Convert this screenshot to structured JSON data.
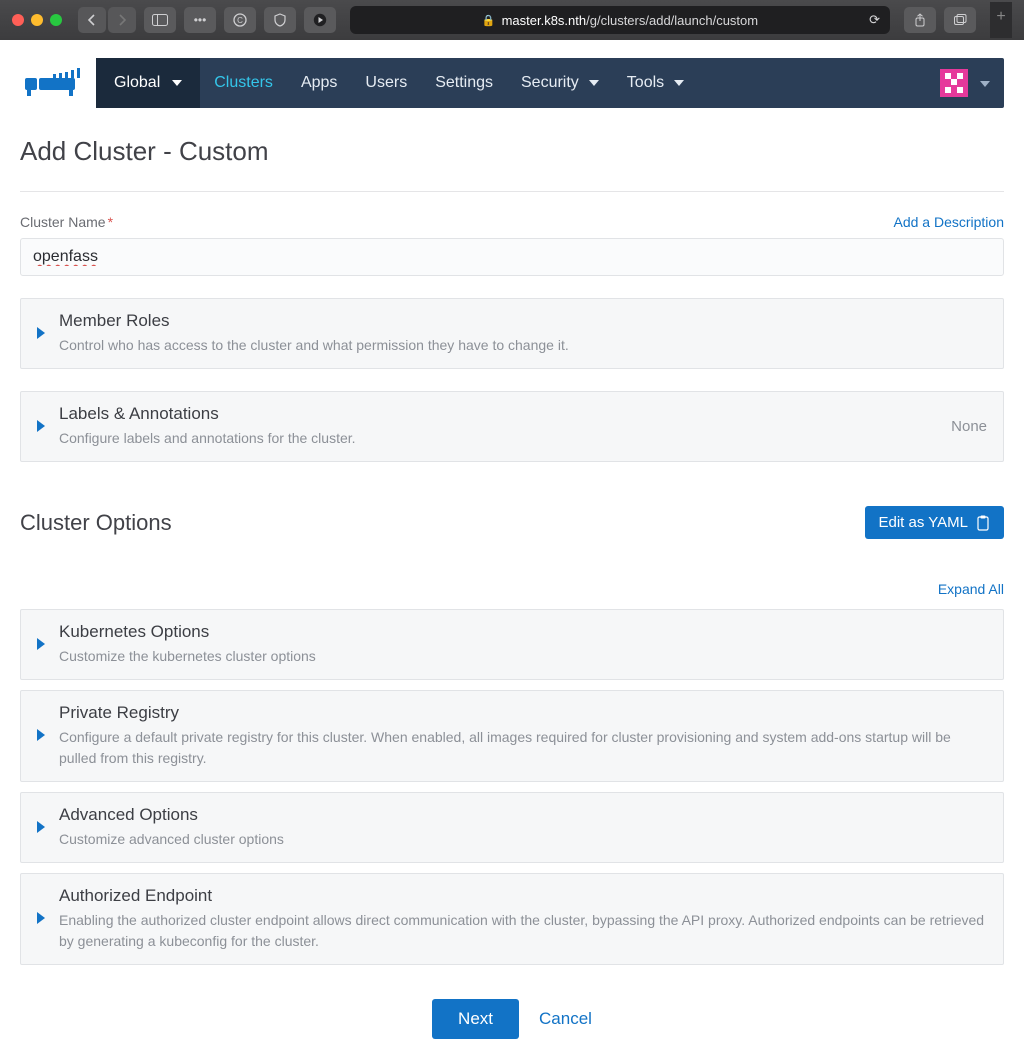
{
  "browser": {
    "url_host": "master.k8s.nth",
    "url_path": "/g/clusters/add/launch/custom"
  },
  "nav": {
    "global_label": "Global",
    "items": [
      {
        "label": "Clusters",
        "active": true
      },
      {
        "label": "Apps"
      },
      {
        "label": "Users"
      },
      {
        "label": "Settings"
      },
      {
        "label": "Security",
        "dropdown": true
      },
      {
        "label": "Tools",
        "dropdown": true
      }
    ]
  },
  "page": {
    "title": "Add Cluster - Custom",
    "cluster_name_label": "Cluster Name",
    "cluster_name_value": "openfass",
    "add_description_link": "Add a Description"
  },
  "accordions_top": [
    {
      "title": "Member Roles",
      "desc": "Control who has access to the cluster and what permission they have to change it.",
      "right": ""
    },
    {
      "title": "Labels & Annotations",
      "desc": "Configure labels and annotations for the cluster.",
      "right": "None"
    }
  ],
  "cluster_options": {
    "heading": "Cluster Options",
    "edit_yaml_label": "Edit as YAML",
    "expand_all_label": "Expand All",
    "items": [
      {
        "title": "Kubernetes Options",
        "desc": "Customize the kubernetes cluster options"
      },
      {
        "title": "Private Registry",
        "desc": "Configure a default private registry for this cluster. When enabled, all images required for cluster provisioning and system add-ons startup will be pulled from this registry."
      },
      {
        "title": "Advanced Options",
        "desc": "Customize advanced cluster options"
      },
      {
        "title": "Authorized Endpoint",
        "desc": "Enabling the authorized cluster endpoint allows direct communication with the cluster, bypassing the API proxy. Authorized endpoints can be retrieved by generating a kubeconfig for the cluster."
      }
    ]
  },
  "footer": {
    "next_label": "Next",
    "cancel_label": "Cancel"
  }
}
